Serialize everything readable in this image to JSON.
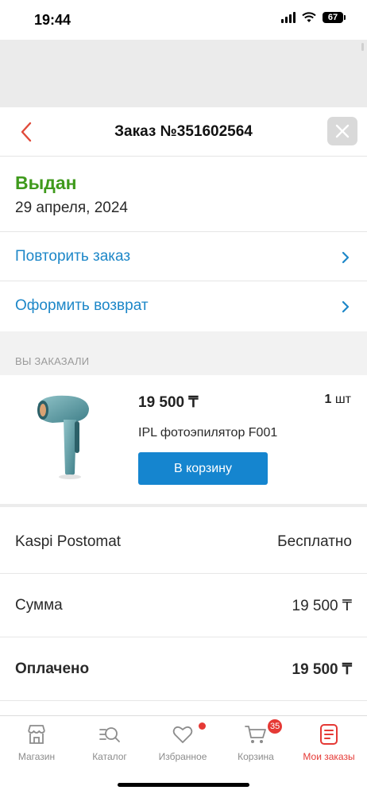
{
  "status_bar": {
    "time": "19:44",
    "battery": "67"
  },
  "header": {
    "title": "Заказ №351602564"
  },
  "order": {
    "status": "Выдан",
    "date": "29 апреля, 2024"
  },
  "actions": {
    "repeat": "Повторить заказ",
    "return": "Оформить возврат"
  },
  "section_label": "ВЫ ЗАКАЗАЛИ",
  "product": {
    "price": "19 500 ₸",
    "qty_number": "1",
    "qty_unit": "шт",
    "name": "IPL фотоэпилятор F001",
    "cart_button": "В корзину"
  },
  "summary": [
    {
      "label": "Kaspi Postomat",
      "value": "Бесплатно"
    },
    {
      "label": "Сумма",
      "value": "19 500 ₸"
    },
    {
      "label": "Оплачено",
      "value": "19 500 ₸"
    }
  ],
  "bottom_nav": [
    {
      "label": "Магазин",
      "icon": "store-icon"
    },
    {
      "label": "Каталог",
      "icon": "catalog-search-icon"
    },
    {
      "label": "Избранное",
      "icon": "heart-icon"
    },
    {
      "label": "Корзина",
      "icon": "cart-icon",
      "badge": "35"
    },
    {
      "label": "Мои заказы",
      "icon": "orders-icon",
      "active": true
    }
  ],
  "colors": {
    "accent_red": "#e53935",
    "link_blue": "#1d87c8",
    "button_blue": "#1585cf",
    "status_green": "#3f9a1c"
  }
}
